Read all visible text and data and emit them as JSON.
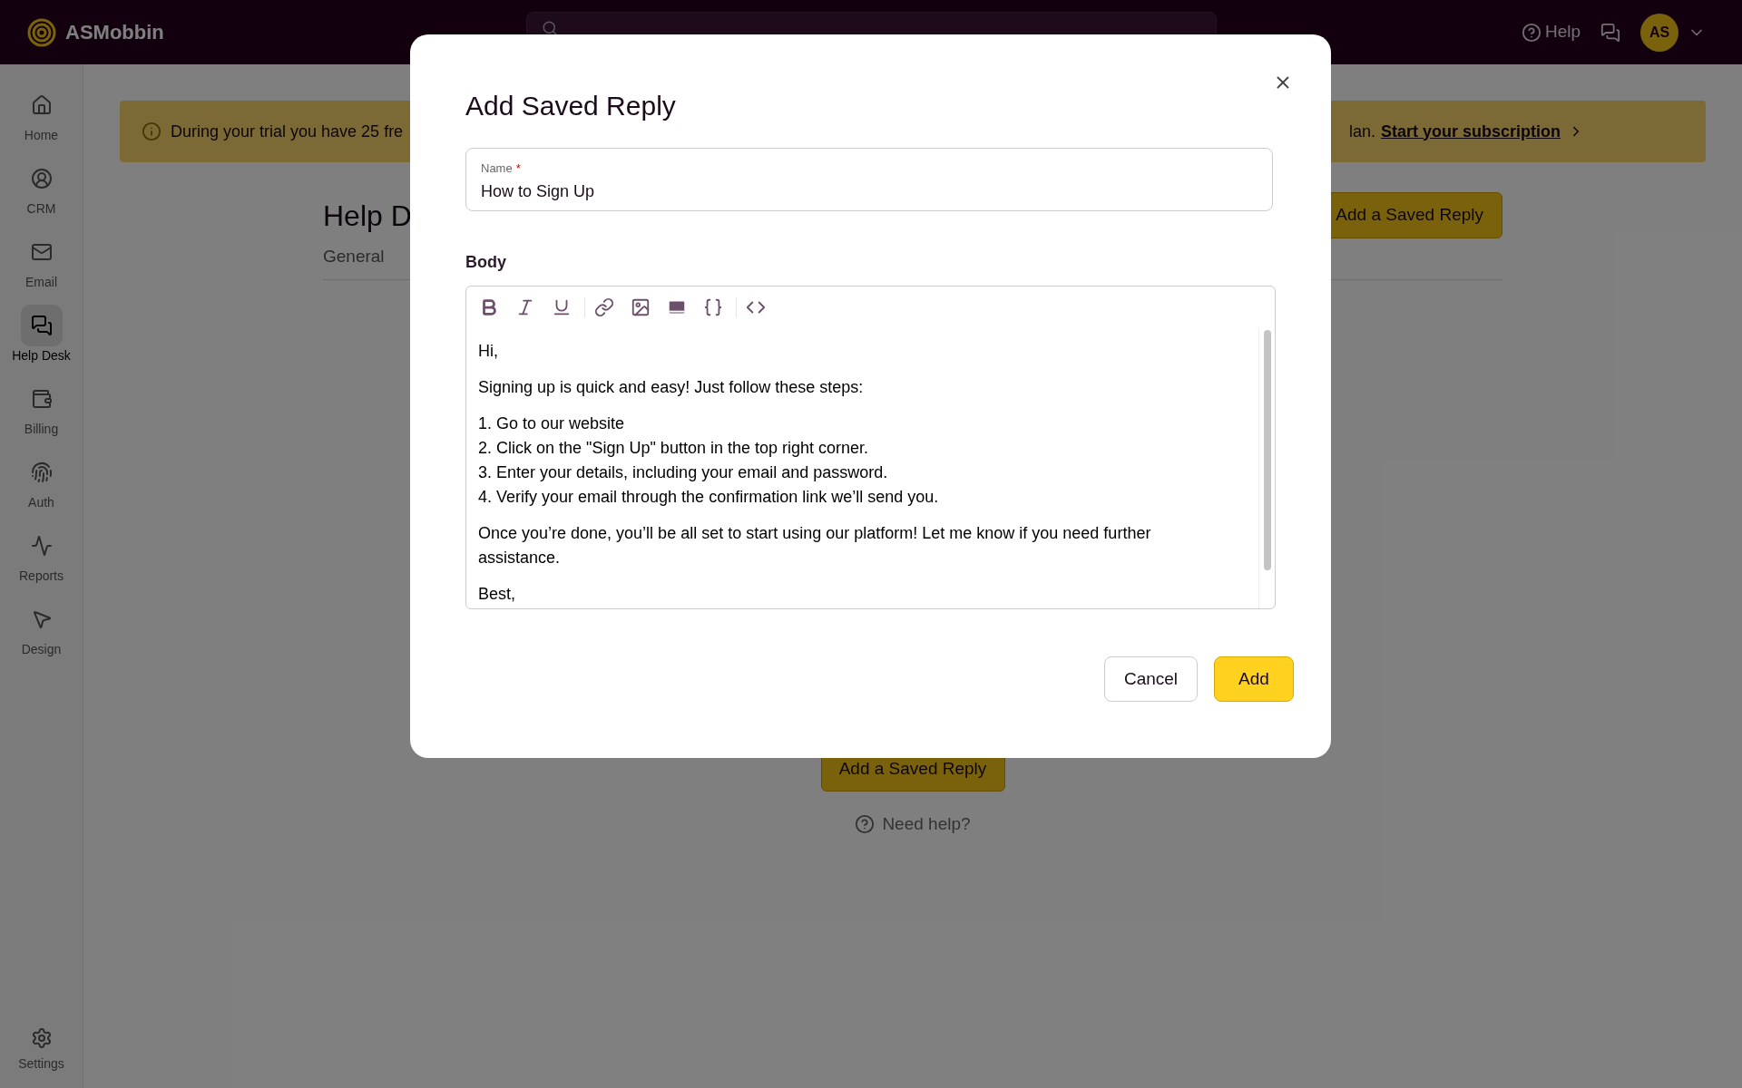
{
  "app": {
    "logo": "ASMobbin",
    "help": "Help",
    "avatar": "AS"
  },
  "sidebar": {
    "items": [
      {
        "label": "Home",
        "selected": false
      },
      {
        "label": "CRM",
        "selected": false
      },
      {
        "label": "Email",
        "selected": false
      },
      {
        "label": "Help Desk",
        "selected": true
      },
      {
        "label": "Billing",
        "selected": false
      },
      {
        "label": "Auth",
        "selected": false
      },
      {
        "label": "Reports",
        "selected": false
      },
      {
        "label": "Design",
        "selected": false
      }
    ],
    "footer": {
      "label": "Settings"
    }
  },
  "banner": {
    "text_start": "During your trial you have 25 fre",
    "text_end": "lan.",
    "link": "Start your subscription"
  },
  "page": {
    "title": "Help D",
    "tabs": [
      "General"
    ],
    "add_button": "Add a Saved Reply",
    "empty_add_button": "Add a Saved Reply",
    "help_link": "Need help?"
  },
  "dialog": {
    "title": "Add Saved Reply",
    "name_field": {
      "label": "Name",
      "required_mark": "*",
      "value": "How to Sign Up"
    },
    "body_label": "Body",
    "body": [
      {
        "kind": "paragraph",
        "text": "Hi,"
      },
      {
        "kind": "paragraph",
        "text": "Signing up is quick and easy! Just follow these steps:"
      },
      {
        "kind": "list",
        "items": [
          "1. Go to our website",
          "2. Click on the \"Sign Up\" button in the top right corner.",
          "3. Enter your details, including your email and password.",
          "4. Verify your email through the confirmation link we’ll send you."
        ]
      },
      {
        "kind": "paragraph",
        "text": "Once you’re done, you’ll be all set to start using our platform! Let me know if you need further assistance."
      },
      {
        "kind": "paragraph",
        "text": "Best,"
      }
    ],
    "buttons": [
      {
        "label": "Cancel",
        "kind": "secondary"
      },
      {
        "label": "Add",
        "kind": "primary"
      }
    ]
  }
}
